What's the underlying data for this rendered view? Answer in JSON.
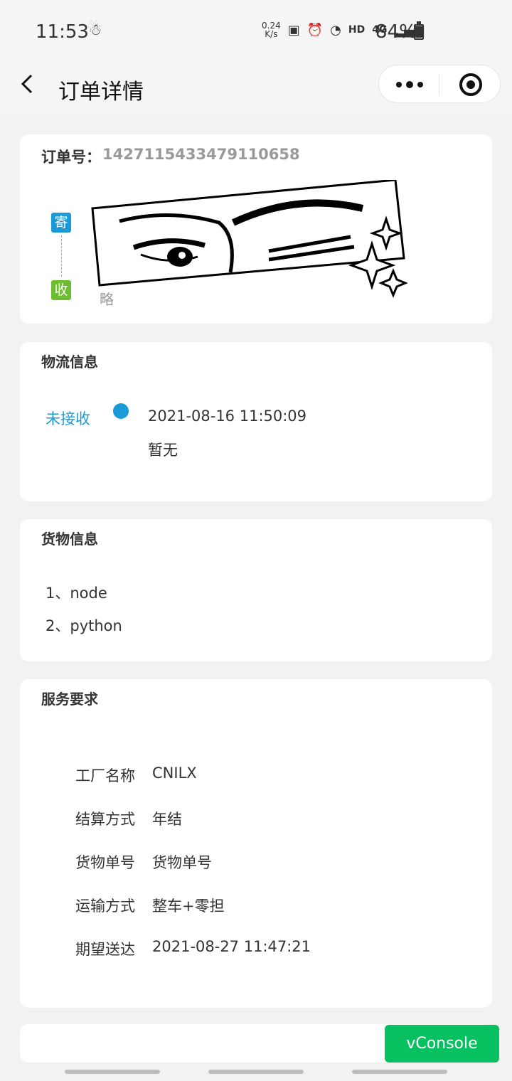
{
  "status_bar": {
    "time": "11:53",
    "speed_value": "0.24",
    "speed_unit": "K/s",
    "hd": "HD",
    "network": "4G",
    "battery": "84%"
  },
  "nav": {
    "title": "订单详情"
  },
  "order": {
    "label": "订单号：",
    "number": "1427115433479110658",
    "send_tag": "寄",
    "receive_tag": "收",
    "omitted_text": "略"
  },
  "logistics": {
    "title": "物流信息",
    "status": "未接收",
    "time": "2021-08-16 11:50:09",
    "desc": "暂无",
    "accent": "#1a9bd8"
  },
  "goods": {
    "title": "货物信息",
    "items": [
      "1、node",
      "2、python"
    ]
  },
  "service": {
    "title": "服务要求",
    "rows": [
      {
        "label": "工厂名称",
        "value": "CNILX"
      },
      {
        "label": "结算方式",
        "value": "年结"
      },
      {
        "label": "货物单号",
        "value": "货物单号"
      },
      {
        "label": "运输方式",
        "value": "整车+零担"
      },
      {
        "label": "期望送达",
        "value": "2021-08-27 11:47:21"
      }
    ]
  },
  "vconsole": {
    "label": "vConsole",
    "color": "#07c160"
  }
}
